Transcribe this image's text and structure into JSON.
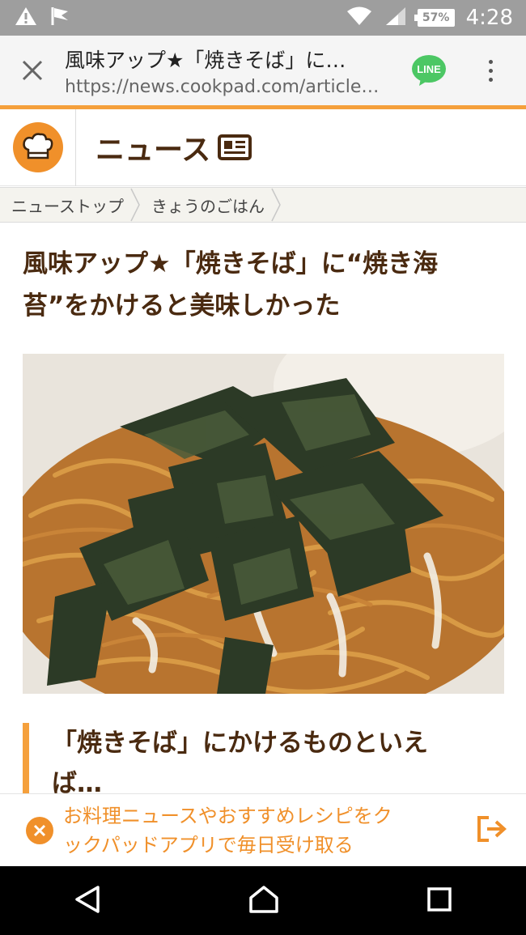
{
  "status_bar": {
    "battery_label": "57%",
    "time": "4:28",
    "icons": [
      "warning-icon",
      "notification-flag-icon",
      "wifi-icon",
      "cell-signal-icon",
      "battery-icon"
    ]
  },
  "browser": {
    "page_title": "風味アップ★「焼きそば」に…",
    "url": "https://news.cookpad.com/article…",
    "line_label": "LINE"
  },
  "site": {
    "section_title": "ニュース"
  },
  "breadcrumb": {
    "items": [
      "ニューストップ",
      "きょうのごはん"
    ]
  },
  "article": {
    "title_line1": "風味アップ★「焼きそば」に“焼き海",
    "title_line2": "苔”をかけると美味しかった",
    "section_heading_line1": "「焼きそば」にかけるものといえ",
    "section_heading_line2": "ば…"
  },
  "app_banner": {
    "line1": "お料理ニュースやおすすめレシピをク",
    "line2": "ックパッドアプリで毎日受け取る"
  },
  "colors": {
    "accent": "#f5a03c",
    "brand_brown": "#4a2a10",
    "line_green": "#4cc764"
  }
}
